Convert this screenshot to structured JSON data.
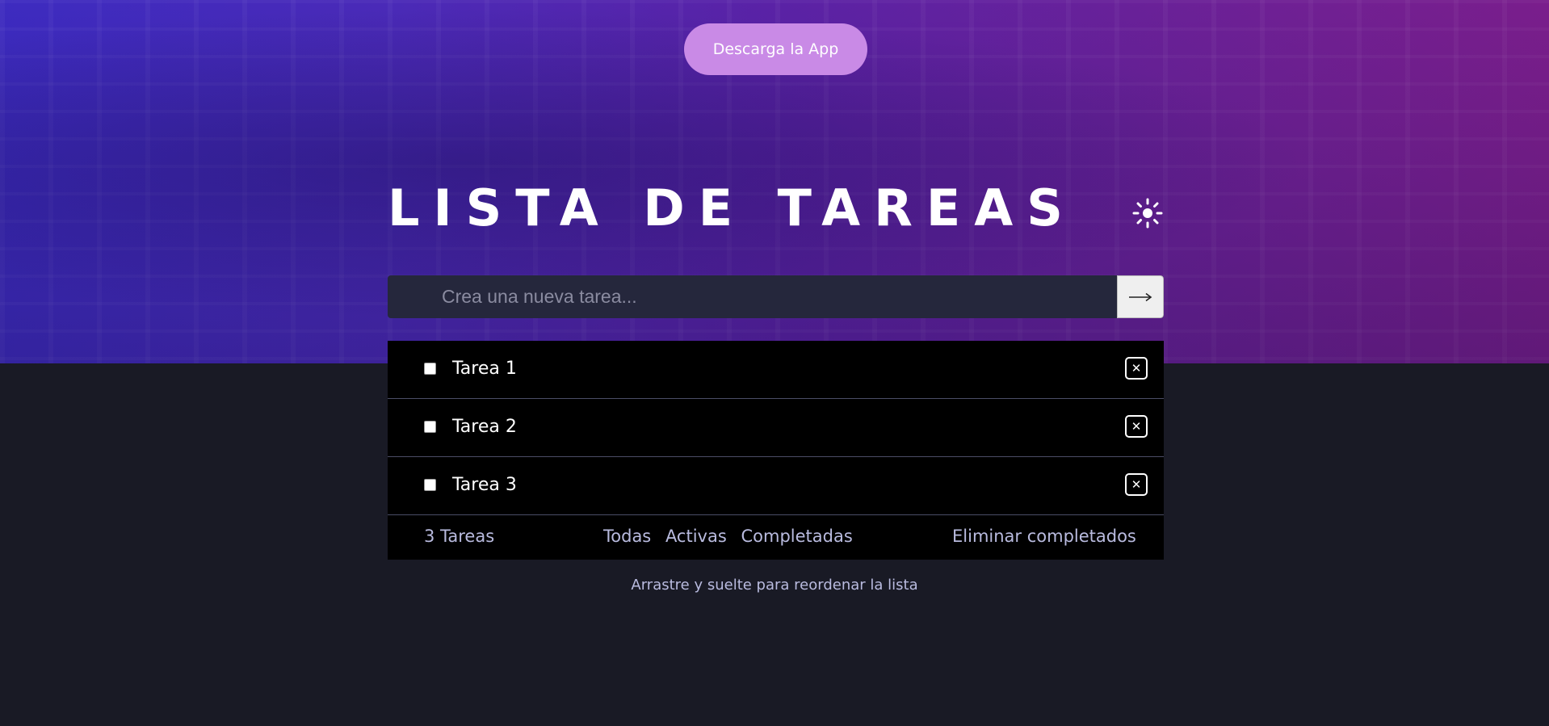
{
  "header": {
    "download_label": "Descarga la App",
    "title": "LISTA DE TAREAS",
    "theme_icon": "sun-icon"
  },
  "new_task": {
    "placeholder": "Crea una nueva tarea...",
    "value": "",
    "submit_icon": "arrow-right-icon"
  },
  "tasks": [
    {
      "label": "Tarea 1",
      "completed": false
    },
    {
      "label": "Tarea 2",
      "completed": false
    },
    {
      "label": "Tarea 3",
      "completed": false
    }
  ],
  "footer": {
    "count_label": "3 Tareas",
    "filters": [
      "Todas",
      "Activas",
      "Completadas"
    ],
    "clear_label": "Eliminar completados"
  },
  "hint": "Arrastre y suelte para reordenar la lista",
  "colors": {
    "accent_button": "#c98ae6",
    "page_background": "#191a25",
    "input_background": "#25273c",
    "list_background": "#000000",
    "muted_text": "#b9bbdf"
  }
}
